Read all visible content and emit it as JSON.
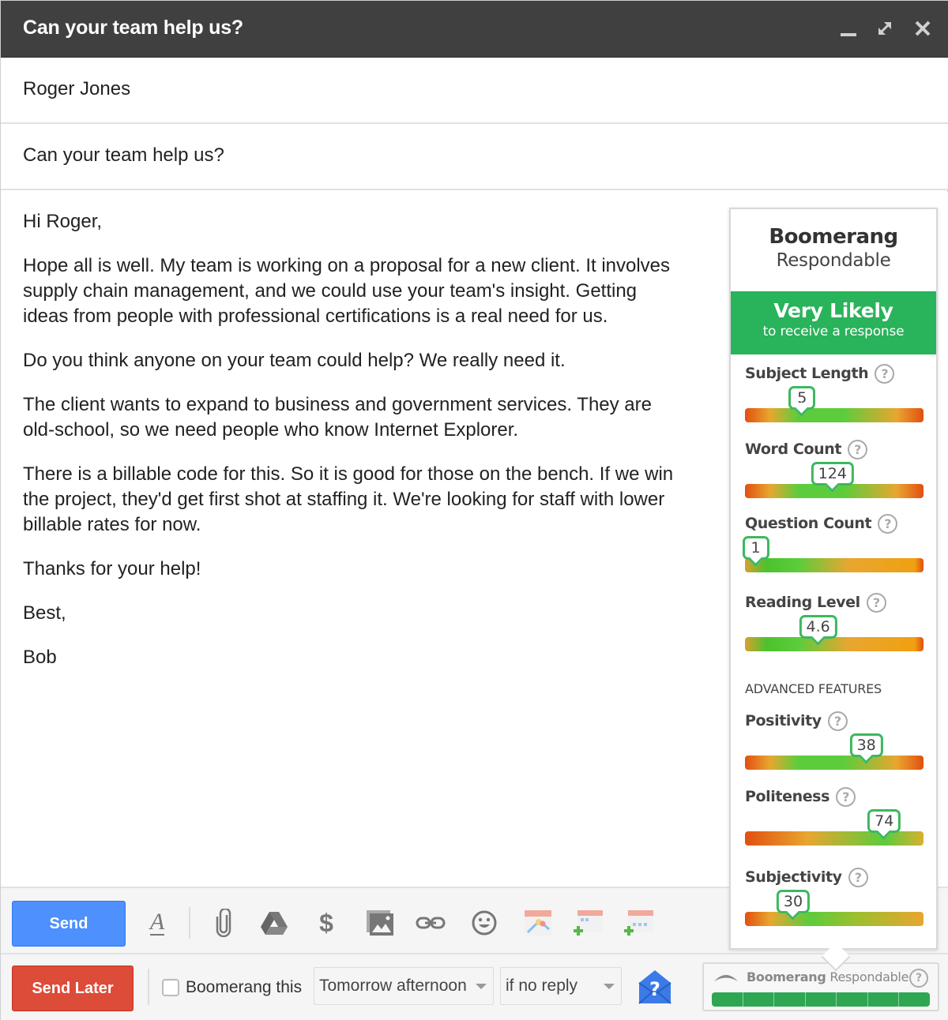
{
  "window": {
    "title": "Can your team help us?",
    "controls": {
      "minimize": "minimize-icon",
      "expand": "expand-icon",
      "close": "close-icon"
    }
  },
  "compose": {
    "to": "Roger Jones",
    "subject": "Can your team help us?",
    "body": [
      "Hi Roger,",
      "Hope all is well. My team is working on a proposal for a new client. It involves supply chain management, and we could use your team's insight. Getting ideas from people with professional certifications is a real need for us.",
      "Do you think anyone on your team could help? We really need it.",
      "The client wants to expand to business and government services. They are old-school, so we need people who know Internet Explorer.",
      "There is a billable code for this. So it is good for those on the bench. If we win the project, they'd get first shot at staffing it. We're looking for staff with lower billable rates for now.",
      "Thanks for your help!",
      "Best,",
      "Bob"
    ]
  },
  "respondable": {
    "brand_bold": "Boomerang",
    "brand_light": "Respondable",
    "verdict": "Very Likely",
    "verdict_sub": "to receive a response",
    "verdict_color": "#29b35a",
    "help_symbol": "?",
    "advanced_label": "ADVANCED FEATURES",
    "metrics": [
      {
        "label": "Subject Length",
        "value": "5",
        "marker_fraction": 0.32,
        "gradient": "redgreenred"
      },
      {
        "label": "Word Count",
        "value": "124",
        "marker_fraction": 0.49,
        "gradient": "redgreenred"
      },
      {
        "label": "Question Count",
        "value": "1",
        "marker_fraction": 0.06,
        "gradient": "greenorange"
      },
      {
        "label": "Reading Level",
        "value": "4.6",
        "marker_fraction": 0.41,
        "gradient": "greenorange"
      },
      {
        "label": "Positivity",
        "value": "38",
        "marker_fraction": 0.68,
        "gradient": "redgreenred"
      },
      {
        "label": "Politeness",
        "value": "74",
        "marker_fraction": 0.78,
        "gradient": "redtogreen"
      },
      {
        "label": "Subjectivity",
        "value": "30",
        "marker_fraction": 0.27,
        "gradient": "redgreenorange"
      }
    ]
  },
  "toolbar": {
    "send_label": "Send",
    "icons": [
      "text-format-icon",
      "attach-icon",
      "drive-icon",
      "money-icon",
      "image-icon",
      "link-icon",
      "emoji-icon",
      "calendar-icon",
      "add-event-icon",
      "add-availability-icon"
    ],
    "dollar_glyph": "$",
    "format_glyph": "A"
  },
  "boomerang_bar": {
    "send_later_label": "Send Later",
    "checkbox_label": "Boomerang this",
    "checkbox_checked": false,
    "when_value": "Tomorrow afternoon",
    "condition_value": "if no reply",
    "help_glyph": "?",
    "mini_brand_bold": "Boomerang",
    "mini_brand_light": "Respondable",
    "mini_help": "?",
    "mini_meter_segments": 7,
    "mini_meter_fill": 1.0
  }
}
